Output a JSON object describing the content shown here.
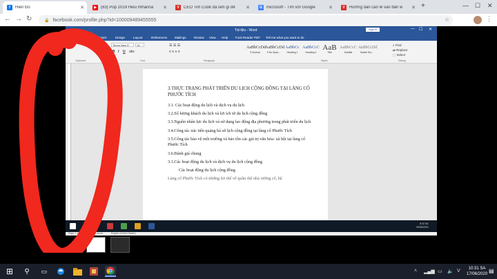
{
  "browser": {
    "tabs": [
      {
        "title": "Hiền Đỗ",
        "favicon_color": "#1877f2",
        "favicon_letter": "f",
        "active": true
      },
      {
        "title": "(83) Pop 2019 Hiếu Rihanna",
        "favicon_color": "#ff0000",
        "favicon_letter": "▶",
        "active": false
      },
      {
        "title": "CEO Tim Cook đã làm gì để",
        "favicon_color": "#d93025",
        "favicon_letter": "V",
        "active": false
      },
      {
        "title": "microsoft - Tìm với Google",
        "favicon_color": "#4285f4",
        "favicon_letter": "G",
        "active": false
      },
      {
        "title": "Hướng dẫn cần lề văn bản w",
        "favicon_color": "#d93025",
        "favicon_letter": "V",
        "active": false
      }
    ],
    "url": "facebook.com/profile.php?id=100009489455555"
  },
  "word": {
    "doc_title": "Tài liệu - Word",
    "sign_in": "Sign in",
    "menu": [
      "File",
      "Home",
      "Insert",
      "Design",
      "Layout",
      "References",
      "Mailings",
      "Review",
      "View",
      "Help",
      "Foxit Reader PDF",
      "Tell me what you want to do"
    ],
    "font_name": "Times New R",
    "font_size": "14",
    "styles": [
      {
        "sample": "AaBbCcDd",
        "name": "¶ Normal"
      },
      {
        "sample": "AaBbCcDd",
        "name": "¶ No Spac..."
      },
      {
        "sample": "AaBbCc",
        "name": "Heading 1"
      },
      {
        "sample": "AaBbCcC",
        "name": "Heading 2"
      },
      {
        "sample": "AaB",
        "name": "Title"
      },
      {
        "sample": "AaBbCcC",
        "name": "Subtitle"
      },
      {
        "sample": "AaBbCcDd",
        "name": "Subtle Em..."
      }
    ],
    "ribbon_groups": [
      "Clipboard",
      "Font",
      "Paragraph",
      "Styles",
      "Editing"
    ],
    "editing": [
      "Find",
      "Replace",
      "Select"
    ],
    "paragraphs": [
      "3.THỰC TRẠNG PHÁT TRIỂN DU LỊCH CỘNG ĐỒNG TẠI LÀNG CỔ PHƯỚC TÍCH",
      "3.1. Các hoạt động du lịch và dịch vụ du lịch",
      "3.2.Số lượng khách du lịch và lợi ích từ du lịch cộng đồng",
      "3.3.Nguồn nhân lực du lịch và sử dụng lao động địa phương trong phát triển du lịch",
      "3.4.Công tác xúc tiến quảng bá sứ lịch cộng đồng tại làng cổ Phước Tích",
      "3.5.Công tác bảo vệ môi trường và bảo tồn các giá trị văn hóa- xã hội tại làng cổ Phước Tích",
      "3.6.Đánh giá chung",
      "3.1.Các hoạt động du lịch và dịch vụ du lịch cộng đồng",
      "Các hoạt động du lịch cộng đồng",
      "Làng cổ Phước Tích có những lợi thế về quần thể nhà rường cổ, hệ"
    ],
    "status_page": "Page 1 of 4",
    "status_words": "1281 words",
    "status_lang": "English (United States)",
    "inner_clock_time": "8:22 SA",
    "inner_clock_date": "30/06/2020"
  },
  "taskbar": {
    "time": "10:31 SA",
    "date": "17/06/2020"
  },
  "colors": {
    "word_blue": "#2b579a",
    "annotation_red": "#f0281e"
  }
}
